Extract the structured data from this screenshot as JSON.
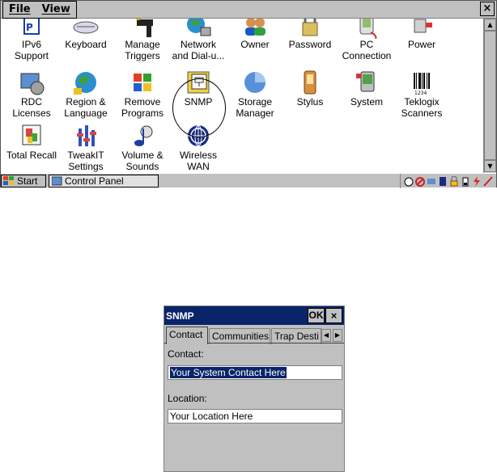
{
  "control_panel": {
    "menu": {
      "file": "File",
      "view": "View"
    },
    "close": "×",
    "items": [
      {
        "label_1": "IPv6",
        "label_2": "Support",
        "icon": "ipv6-icon"
      },
      {
        "label_1": "Keyboard",
        "label_2": "",
        "icon": "keyboard-icon"
      },
      {
        "label_1": "Manage",
        "label_2": "Triggers",
        "icon": "triggers-icon"
      },
      {
        "label_1": "Network",
        "label_2": "and Dial-u...",
        "icon": "network-icon"
      },
      {
        "label_1": "Owner",
        "label_2": "",
        "icon": "owner-icon"
      },
      {
        "label_1": "Password",
        "label_2": "",
        "icon": "password-icon"
      },
      {
        "label_1": "PC",
        "label_2": "Connection",
        "icon": "pc-connection-icon"
      },
      {
        "label_1": "Power",
        "label_2": "",
        "icon": "power-icon"
      },
      {
        "label_1": "RDC",
        "label_2": "Licenses",
        "icon": "rdc-icon"
      },
      {
        "label_1": "Region &",
        "label_2": "Language",
        "icon": "globe-icon"
      },
      {
        "label_1": "Remove",
        "label_2": "Programs",
        "icon": "windows-flag-icon"
      },
      {
        "label_1": "SNMP",
        "label_2": "",
        "icon": "snmp-icon"
      },
      {
        "label_1": "Storage",
        "label_2": "Manager",
        "icon": "storage-icon"
      },
      {
        "label_1": "Stylus",
        "label_2": "",
        "icon": "stylus-icon"
      },
      {
        "label_1": "System",
        "label_2": "",
        "icon": "system-icon"
      },
      {
        "label_1": "Teklogix",
        "label_2": "Scanners",
        "icon": "barcode-icon"
      },
      {
        "label_1": "Total Recall",
        "label_2": "",
        "icon": "total-recall-icon"
      },
      {
        "label_1": "TweakIT",
        "label_2": "Settings",
        "icon": "tweakit-icon"
      },
      {
        "label_1": "Volume &",
        "label_2": "Sounds",
        "icon": "volume-icon"
      },
      {
        "label_1": "Wireless",
        "label_2": "WAN",
        "icon": "wireless-icon"
      }
    ]
  },
  "taskbar": {
    "start": "Start",
    "task": "Control Panel"
  },
  "snmp_dialog": {
    "title": "SNMP",
    "ok": "OK",
    "close": "×",
    "tabs": [
      "Contact",
      "Communities",
      "Trap Desti"
    ],
    "contact_label": "Contact:",
    "contact_value": "Your System Contact Here",
    "location_label": "Location:",
    "location_value": "Your Location Here"
  },
  "colors": {
    "titlebar": "#0a246a",
    "chrome": "#c0c0c0",
    "selection": "#0a246a"
  }
}
